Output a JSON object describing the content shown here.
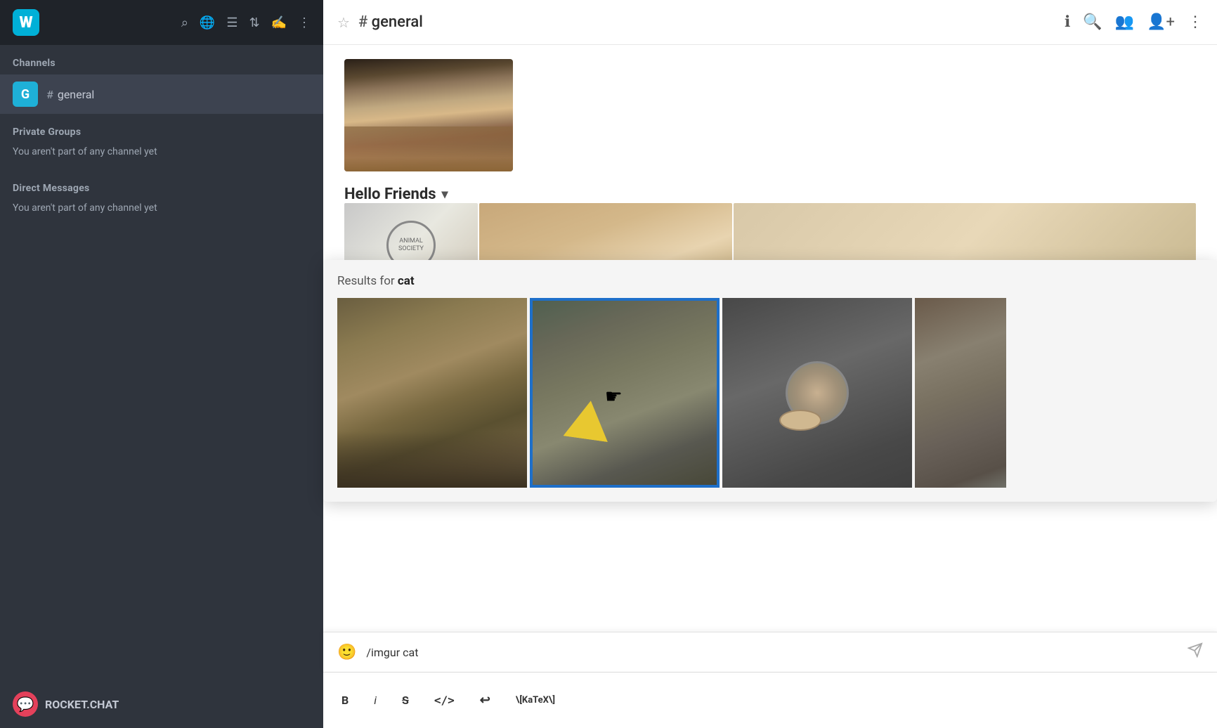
{
  "sidebar": {
    "logo_letter": "W",
    "search_icon": "search",
    "globe_icon": "globe",
    "list_icon": "list",
    "sort_icon": "sort",
    "compose_icon": "compose",
    "more_icon": "more",
    "sections": {
      "channels": {
        "label": "Channels",
        "items": [
          {
            "avatar_letter": "G",
            "hash": "#",
            "name": "general"
          }
        ]
      },
      "private_groups": {
        "label": "Private Groups",
        "empty_text": "You aren't part of any channel yet"
      },
      "direct_messages": {
        "label": "Direct Messages",
        "empty_text": "You aren't part of any channel yet"
      }
    },
    "footer": {
      "brand": "ROCKET.CHAT"
    }
  },
  "header": {
    "channel_hash": "#",
    "channel_name": "general",
    "star_icon": "star",
    "info_icon": "info",
    "search_icon": "search",
    "members_icon": "members",
    "add_member_icon": "add-member",
    "more_icon": "more"
  },
  "chat": {
    "messages": [
      {
        "type": "image",
        "image_desc": "cat on wooden floor"
      },
      {
        "type": "section",
        "label": "Hello Friends",
        "has_dropdown": true,
        "images": [
          "animal badge",
          "tan surface",
          "beige/tan image"
        ]
      }
    ]
  },
  "search_overlay": {
    "label_prefix": "Results for",
    "search_term": "cat",
    "images": [
      {
        "desc": "bobcat pair on porch",
        "selected": false
      },
      {
        "desc": "person holding tabby cat with yellow object",
        "selected": true
      },
      {
        "desc": "cat near food bowl on table",
        "selected": false
      },
      {
        "desc": "partial cat image",
        "selected": false
      }
    ]
  },
  "input": {
    "emoji_icon": "emoji",
    "value": "/imgur cat",
    "send_icon": "send"
  },
  "toolbar": {
    "bold": "B",
    "italic": "i",
    "strikethrough": "S",
    "code": "</>",
    "link": "↩",
    "katex": "\\[KaTeX\\]"
  }
}
